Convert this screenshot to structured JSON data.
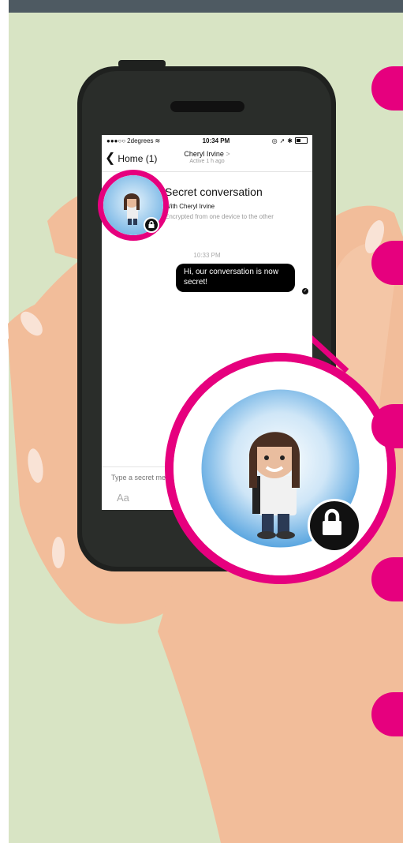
{
  "status_bar": {
    "carrier": "2degrees",
    "time": "10:34 PM"
  },
  "nav": {
    "back_label": "Home (1)",
    "contact_name": "Cheryl Irvine",
    "active_status": "Active 1 h ago"
  },
  "header": {
    "title": "Secret conversation",
    "with": "With Cheryl Irvine",
    "encryption_note": "Encrypted from one device to the other"
  },
  "messages": [
    {
      "time": "10:33 PM",
      "text": "Hi, our conversation is now secret!"
    }
  ],
  "composer": {
    "placeholder": "Type a secret message...",
    "aa_label": "Aa"
  },
  "colors": {
    "accent": "#e6007e",
    "background": "#d8e4c4",
    "skin": "#f2bd9a",
    "phone_body": "#1f211f"
  }
}
